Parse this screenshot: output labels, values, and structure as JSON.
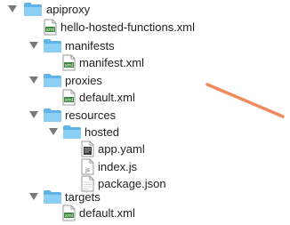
{
  "tree": {
    "root": {
      "label": "apiproxy",
      "icon": "folder-icon"
    },
    "hello_file": {
      "label": "hello-hosted-functions.xml",
      "icon": "xml-file-icon"
    },
    "manifests": {
      "label": "manifests",
      "icon": "folder-icon"
    },
    "manifest_file": {
      "label": "manifest.xml",
      "icon": "xml-file-icon"
    },
    "proxies": {
      "label": "proxies",
      "icon": "folder-icon"
    },
    "proxies_default": {
      "label": "default.xml",
      "icon": "xml-file-icon"
    },
    "resources": {
      "label": "resources",
      "icon": "folder-icon"
    },
    "hosted": {
      "label": "hosted",
      "icon": "folder-icon"
    },
    "app_yaml": {
      "label": "app.yaml",
      "icon": "text-file-icon"
    },
    "index_js": {
      "label": "index.js",
      "icon": "js-file-icon"
    },
    "package_json": {
      "label": "package.json",
      "icon": "document-file-icon"
    },
    "targets": {
      "label": "targets",
      "icon": "folder-icon"
    },
    "targets_default": {
      "label": "default.xml",
      "icon": "xml-file-icon"
    }
  },
  "icons": {
    "xml_badge": "xml",
    "js_badge": "js"
  },
  "colors": {
    "folder_light": "#8ccff5",
    "folder_dark": "#5fb3e6",
    "arrow": "#f08a5d",
    "disclosure": "#7a7a7a"
  }
}
